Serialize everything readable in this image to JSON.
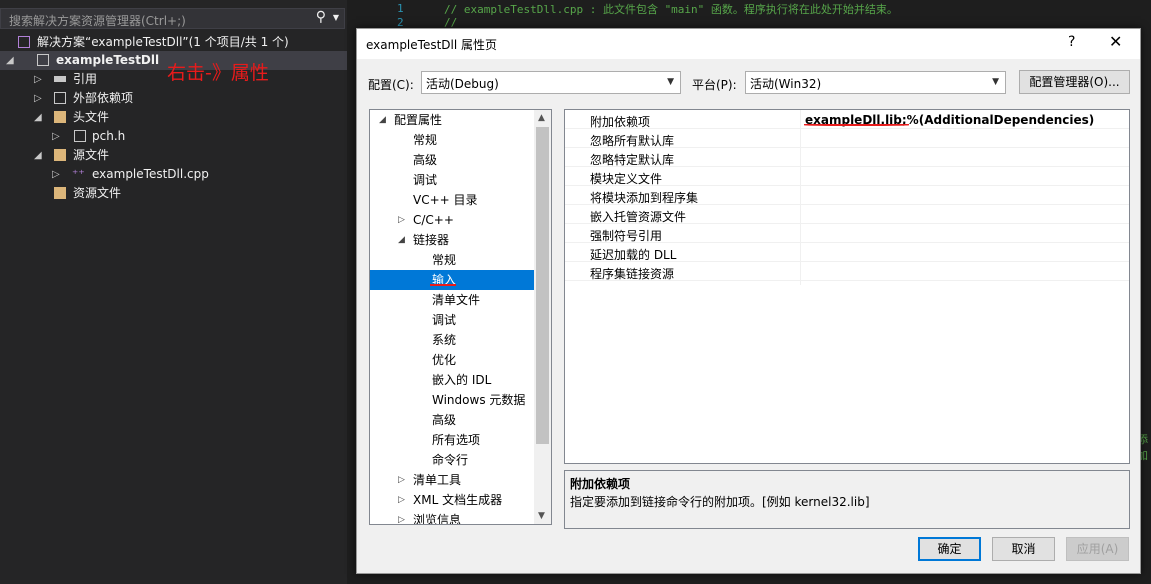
{
  "solution_explorer": {
    "search_placeholder": "搜索解决方案资源管理器(Ctrl+;)",
    "items": [
      {
        "label": "解决方案“exampleTestDll”(1 个项目/共 1 个)"
      },
      {
        "label": "exampleTestDll"
      },
      {
        "label": "引用"
      },
      {
        "label": "外部依赖项"
      },
      {
        "label": "头文件"
      },
      {
        "label": "pch.h"
      },
      {
        "label": "源文件"
      },
      {
        "label": "exampleTestDll.cpp"
      },
      {
        "label": "资源文件"
      }
    ],
    "annotation": "右击-》属性"
  },
  "editor": {
    "line_numbers": [
      "1",
      "2"
    ],
    "lines": [
      "// exampleTestDll.cpp : 此文件包含 \"main\" 函数。程序执行将在此处开始并结束。",
      "//"
    ],
    "overflow_text": "添加"
  },
  "dialog": {
    "title": "exampleTestDll 属性页",
    "help": "?",
    "close": "✕",
    "config_label": "配置(C):",
    "config_value": "活动(Debug)",
    "platform_label": "平台(P):",
    "platform_value": "活动(Win32)",
    "config_manager_button": "配置管理器(O)...",
    "tree": [
      {
        "label": "配置属性",
        "level": 0,
        "arrow": "◢"
      },
      {
        "label": "常规",
        "level": 1
      },
      {
        "label": "高级",
        "level": 1
      },
      {
        "label": "调试",
        "level": 1
      },
      {
        "label": "VC++ 目录",
        "level": 1
      },
      {
        "label": "C/C++",
        "level": 1,
        "arrow": "▷"
      },
      {
        "label": "链接器",
        "level": 1,
        "arrow": "◢"
      },
      {
        "label": "常规",
        "level": 2
      },
      {
        "label": "输入",
        "level": 2,
        "selected": true
      },
      {
        "label": "清单文件",
        "level": 2
      },
      {
        "label": "调试",
        "level": 2
      },
      {
        "label": "系统",
        "level": 2
      },
      {
        "label": "优化",
        "level": 2
      },
      {
        "label": "嵌入的 IDL",
        "level": 2
      },
      {
        "label": "Windows 元数据",
        "level": 2
      },
      {
        "label": "高级",
        "level": 2
      },
      {
        "label": "所有选项",
        "level": 2
      },
      {
        "label": "命令行",
        "level": 2
      },
      {
        "label": "清单工具",
        "level": 1,
        "arrow": "▷"
      },
      {
        "label": "XML 文档生成器",
        "level": 1,
        "arrow": "▷"
      },
      {
        "label": "浏览信息",
        "level": 1,
        "arrow": "▷"
      }
    ],
    "properties": [
      {
        "name": "附加依赖项",
        "value": "exampleDll.lib;%(AdditionalDependencies)"
      },
      {
        "name": "忽略所有默认库",
        "value": ""
      },
      {
        "name": "忽略特定默认库",
        "value": ""
      },
      {
        "name": "模块定义文件",
        "value": ""
      },
      {
        "name": "将模块添加到程序集",
        "value": ""
      },
      {
        "name": "嵌入托管资源文件",
        "value": ""
      },
      {
        "name": "强制符号引用",
        "value": ""
      },
      {
        "name": "延迟加载的 DLL",
        "value": ""
      },
      {
        "name": "程序集链接资源",
        "value": ""
      }
    ],
    "description_title": "附加依赖项",
    "description_text": "指定要添加到链接命令行的附加项。[例如 kernel32.lib]",
    "ok_button": "确定",
    "cancel_button": "取消",
    "apply_button": "应用(A)"
  },
  "colors": {
    "selection": "#0078d7",
    "annotation": "#e81b1b",
    "ide_background": "#252526"
  }
}
